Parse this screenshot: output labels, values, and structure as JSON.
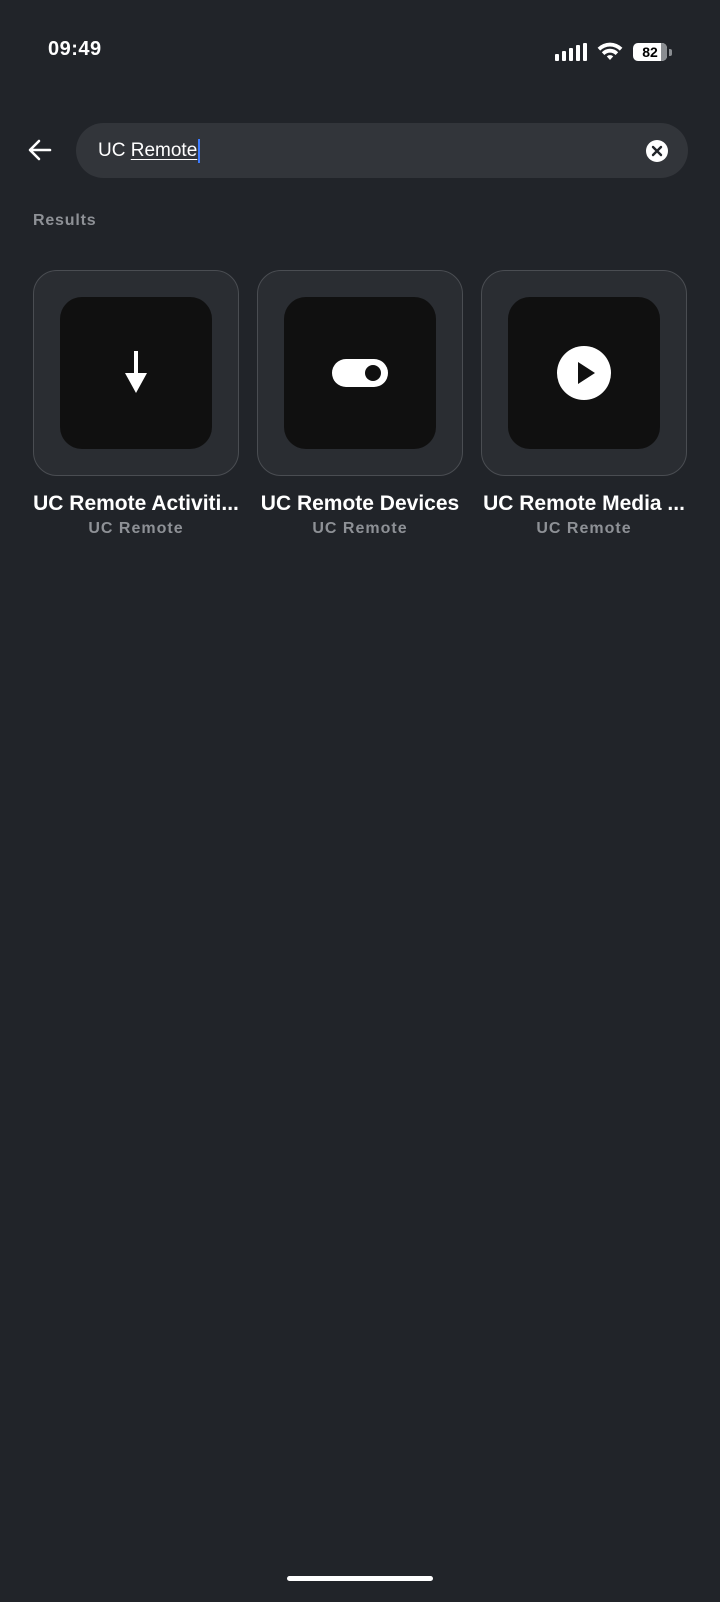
{
  "status_bar": {
    "time": "09:49",
    "battery_percent": "82",
    "battery_level": 0.82,
    "icons": [
      "signal-icon",
      "wifi-icon",
      "battery-icon"
    ]
  },
  "search": {
    "prefix": "UC ",
    "typed": "Remote",
    "back_icon": "arrow-left-icon",
    "clear_icon": "clear-circle-icon"
  },
  "results": {
    "label": "Results",
    "items": [
      {
        "title": "UC Remote Activiti...",
        "subtitle": "UC Remote",
        "icon": "arrow-down-icon"
      },
      {
        "title": "UC Remote Devices",
        "subtitle": "UC Remote",
        "icon": "toggle-icon"
      },
      {
        "title": "UC Remote Media ...",
        "subtitle": "UC Remote",
        "icon": "play-circle-icon"
      }
    ]
  },
  "colors": {
    "background": "#212429",
    "search_bg": "#32353a",
    "caret": "#3d7cff",
    "muted_text": "#8e9196"
  }
}
